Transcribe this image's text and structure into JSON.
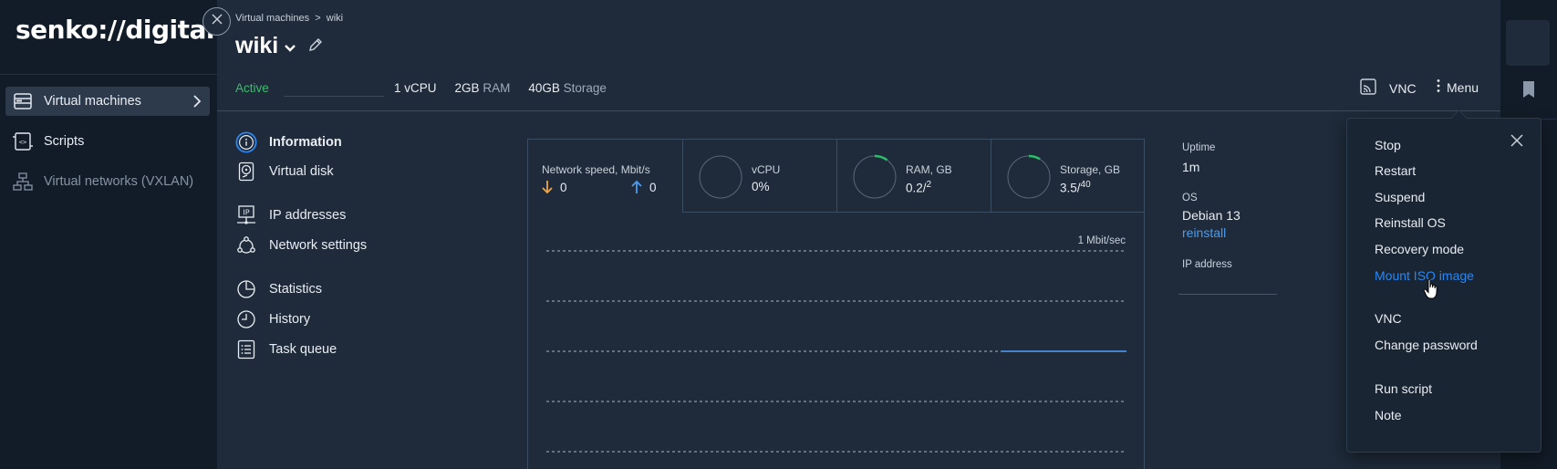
{
  "brand": {
    "logo": "senko://digital"
  },
  "sidebar": {
    "items": [
      {
        "label": "Virtual machines",
        "icon": "server-icon"
      },
      {
        "label": "Scripts",
        "icon": "script-icon"
      },
      {
        "label": "Virtual networks (VXLAN)",
        "icon": "network-icon"
      }
    ]
  },
  "header": {
    "breadcrumb": "Virtual machines  >  wiki",
    "title": "wiki",
    "status": "Active",
    "specs": [
      {
        "value": "1",
        "unit": "vCPU"
      },
      {
        "value": "2GB",
        "unit": "RAM"
      },
      {
        "value": "40GB",
        "unit": "Storage"
      }
    ],
    "vnc_label": "VNC",
    "menu_label": "Menu"
  },
  "nav": {
    "items": [
      {
        "label": "Information",
        "icon": "info-icon"
      },
      {
        "label": "Virtual disk",
        "icon": "disk-icon"
      },
      {
        "label": "IP addresses",
        "icon": "ip-icon"
      },
      {
        "label": "Network settings",
        "icon": "network-settings-icon"
      },
      {
        "label": "Statistics",
        "icon": "pie-chart-icon"
      },
      {
        "label": "History",
        "icon": "clock-icon"
      },
      {
        "label": "Task queue",
        "icon": "task-list-icon"
      }
    ]
  },
  "stats": {
    "network": {
      "title": "Network speed, Mbit/s",
      "down": "0",
      "up": "0"
    },
    "vcpu": {
      "title": "vCPU",
      "value": "0%",
      "fraction": 0
    },
    "ram": {
      "title": "RAM, GB",
      "value": "0.2/",
      "total": "2",
      "fraction": 0.1
    },
    "storage": {
      "title": "Storage, GB",
      "value": "3.5/",
      "total": "40",
      "fraction": 0.0875
    },
    "chart_label": "1 Mbit/sec",
    "accent_green": "#2dbe6c",
    "accent_orange": "#f0a64a",
    "accent_blue": "#4a9cf0"
  },
  "info": {
    "uptime_label": "Uptime",
    "uptime_value": "1m",
    "os_label": "OS",
    "os_value": "Debian 13",
    "os_link": "reinstall",
    "ip_label": "IP address"
  },
  "menu": {
    "items": [
      "Stop",
      "Restart",
      "Suspend",
      "Reinstall OS",
      "Recovery mode",
      "Mount ISO image",
      "VNC",
      "Change password",
      "Run script",
      "Note"
    ],
    "hovered": "Mount ISO image"
  }
}
